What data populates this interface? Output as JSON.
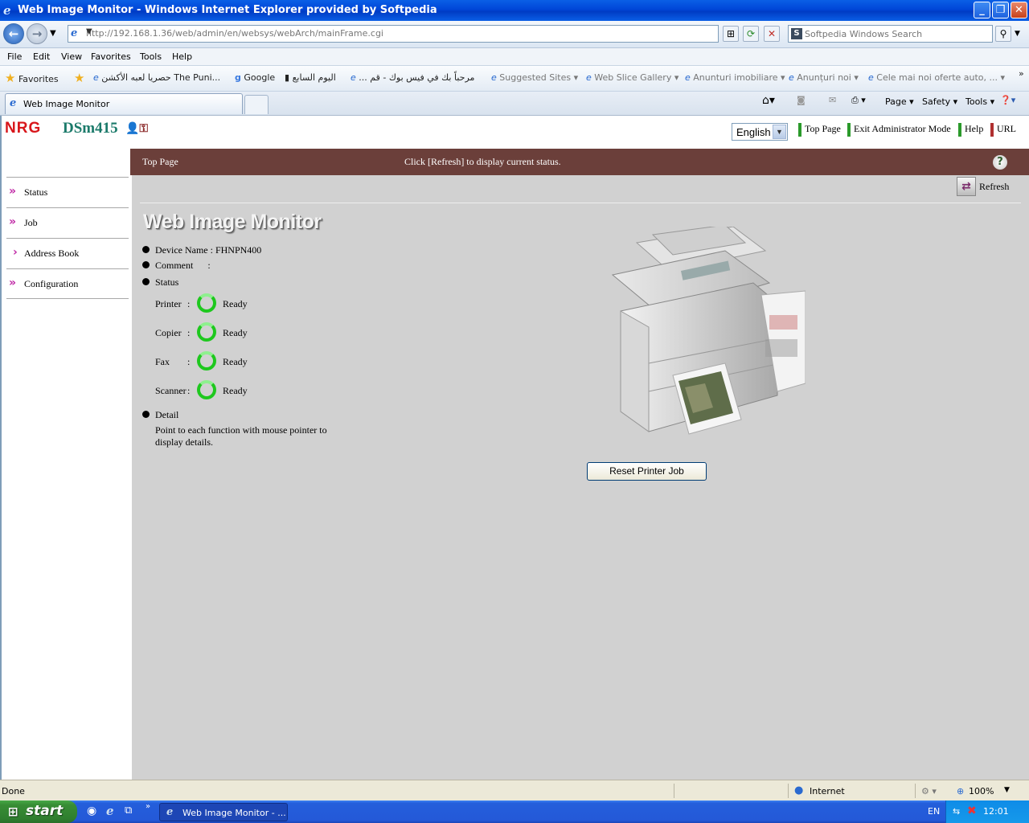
{
  "window": {
    "title": "Web Image Monitor - Windows Internet Explorer provided by Softpedia"
  },
  "address": {
    "url": "http://192.168.1.36/web/admin/en/websys/webArch/mainFrame.cgi"
  },
  "search": {
    "placeholder": "Softpedia Windows Search"
  },
  "menu": [
    "File",
    "Edit",
    "View",
    "Favorites",
    "Tools",
    "Help"
  ],
  "favorites": {
    "label": "Favorites",
    "items": [
      "حصريا لعبه الأكشن The Puni...",
      "Google",
      "اليوم السابع",
      "... مرحباً بك في فيس بوك - قم",
      "Suggested Sites ▾",
      "Web Slice Gallery ▾",
      "Anunturi imobiliare ▾",
      "Anunțuri noi ▾",
      "Cele mai noi oferte auto, ... ▾"
    ]
  },
  "tab": {
    "label": "Web Image Monitor"
  },
  "commands": [
    "Page ▾",
    "Safety ▾",
    "Tools ▾"
  ],
  "header": {
    "brand": "NRG",
    "model": "DSm415",
    "language": "English",
    "links": [
      "Top Page",
      "Exit Administrator Mode",
      "Help",
      "URL"
    ]
  },
  "titlebar": {
    "section": "Top Page",
    "message": "Click [Refresh] to display current status."
  },
  "sidebar": {
    "items": [
      {
        "label": "Status",
        "chevron": "»"
      },
      {
        "label": "Job",
        "chevron": "»"
      },
      {
        "label": "Address Book",
        "chevron": "›"
      },
      {
        "label": "Configuration",
        "chevron": "»"
      }
    ]
  },
  "main": {
    "refresh_label": "Refresh",
    "logo_text": "Web Image Monitor",
    "device_name": "Device Name : FHNPN400",
    "comment": "Comment      :",
    "status_label": "Status",
    "functions": [
      {
        "name": "Printer",
        "state": "Ready"
      },
      {
        "name": "Copier",
        "state": "Ready"
      },
      {
        "name": "Fax",
        "state": "Ready"
      },
      {
        "name": "Scanner",
        "state": "Ready"
      }
    ],
    "detail_label": "Detail",
    "detail_text_1": "Point to each function with mouse pointer to",
    "detail_text_2": "display details.",
    "reset_button": "Reset Printer Job"
  },
  "statusbar": {
    "left": "Done",
    "zone": "Internet",
    "zoom": "100%"
  },
  "taskbar": {
    "start": "start",
    "task": "Web Image Monitor - ...",
    "lang": "EN",
    "time": "12:01"
  },
  "colors": {
    "brand_red": "#d8161b",
    "model_teal": "#1b7a6a",
    "header_band": "#6b3f3a",
    "ready_green": "#1ec81e"
  }
}
